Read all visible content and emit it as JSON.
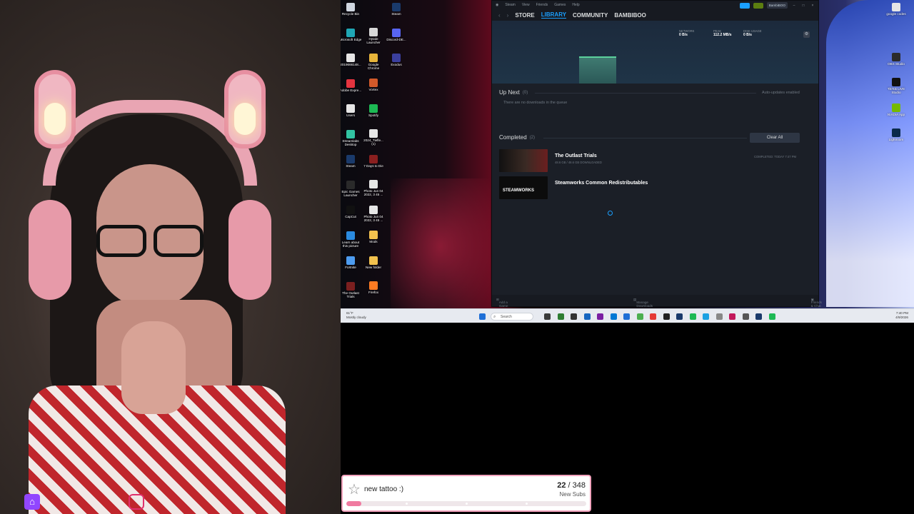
{
  "webcam": {
    "social_icons": [
      "twitch-logo-icon",
      "instagram-logo-icon"
    ]
  },
  "desktop": {
    "icons_col1": [
      {
        "label": "Recycle Bin",
        "icon": "recycle-bin-icon",
        "color": "#cfd6e0"
      },
      {
        "label": "Microsoft Edge",
        "icon": "edge-icon",
        "color": "#1fa7b5"
      },
      {
        "label": "2019666148...",
        "icon": "file-icon",
        "color": "#e6e6e6"
      },
      {
        "label": "Adobe Expre...",
        "icon": "adobe-express-icon",
        "color": "#e4343f"
      },
      {
        "label": "Users",
        "icon": "users-folder-icon",
        "color": "#e6e6e6"
      },
      {
        "label": "Streamlabs Desktop",
        "icon": "streamlabs-icon",
        "color": "#31c3a2"
      },
      {
        "label": "Steam",
        "icon": "steam-icon",
        "color": "#1a3a6b"
      },
      {
        "label": "Epic Games Launcher",
        "icon": "epic-games-icon",
        "color": "#2a2a2a"
      },
      {
        "label": "CapCut",
        "icon": "capcut-icon",
        "color": "#111111"
      },
      {
        "label": "Learn about this picture",
        "icon": "spotlight-icon",
        "color": "#2a8be0"
      },
      {
        "label": "Fortnite",
        "icon": "fortnite-icon",
        "color": "#4d9cf0"
      },
      {
        "label": "The Outlast Trials",
        "icon": "outlast-icon",
        "color": "#7b1f1f"
      }
    ],
    "icons_col2": [
      {
        "label": "Hytale Launcher",
        "icon": "hytale-icon",
        "color": "#d8d8d8"
      },
      {
        "label": "Google Chrome",
        "icon": "chrome-icon",
        "color": "#e7b43a"
      },
      {
        "label": "Vortex",
        "icon": "vortex-icon",
        "color": "#d35a2a"
      },
      {
        "label": "Spotify",
        "icon": "spotify-icon",
        "color": "#1db954"
      },
      {
        "label": "2024_Tiefle... (1)",
        "icon": "file-icon",
        "color": "#e6e6e6"
      },
      {
        "label": "7 Days to Die",
        "icon": "7-days-icon",
        "color": "#8a1f1f"
      },
      {
        "label": "Photo Jun 04 2022, 3 45 ...",
        "icon": "photo-file-icon",
        "color": "#e6e6e6"
      },
      {
        "label": "Photo Jun 04 2022, 3 45 ...",
        "icon": "photo-file-icon",
        "color": "#e6e6e6"
      },
      {
        "label": "Mods",
        "icon": "folder-icon",
        "color": "#f2c14e"
      },
      {
        "label": "New folder",
        "icon": "folder-icon",
        "color": "#f2c14e"
      },
      {
        "label": "Firefox",
        "icon": "firefox-icon",
        "color": "#ff7b22"
      }
    ],
    "icons_col3": [
      {
        "label": "Steam",
        "icon": "steam-icon",
        "color": "#1a3a6b"
      },
      {
        "label": "Discord-DE...",
        "icon": "discord-icon",
        "color": "#5865f2"
      },
      {
        "label": "Exodus",
        "icon": "exodus-icon",
        "color": "#3b3f9e"
      }
    ],
    "icons_right": [
      {
        "label": "google codes",
        "icon": "text-file-icon",
        "color": "#e6e6e6"
      },
      {
        "label": "OBS Studio",
        "icon": "obs-icon",
        "color": "#2b2b2b"
      },
      {
        "label": "TikTok LIVE Studio",
        "icon": "tiktok-icon",
        "color": "#111111"
      },
      {
        "label": "NVIDIA App",
        "icon": "nvidia-icon",
        "color": "#76b900"
      },
      {
        "label": "Lightroom",
        "icon": "lightroom-icon",
        "color": "#0a2a4a"
      }
    ]
  },
  "steam": {
    "menu": [
      "Steam",
      "View",
      "Friends",
      "Games",
      "Help"
    ],
    "user": "BambiBOO",
    "nav_tabs": [
      "STORE",
      "LIBRARY",
      "COMMUNITY",
      "BAMBIBOO"
    ],
    "active_tab": "LIBRARY",
    "stats": [
      {
        "label": "NETWORK",
        "value": "0 B/s"
      },
      {
        "label": "PEAK",
        "value": "112.2 MB/s"
      },
      {
        "label": "DISK USAGE",
        "value": "0 B/s"
      }
    ],
    "up_next": {
      "title": "Up Next",
      "count": "(0)",
      "empty_text": "There are no downloads in the queue",
      "auto_updates": "Auto-updates enabled"
    },
    "completed": {
      "title": "Completed",
      "count": "(2)",
      "clear_label": "Clear All"
    },
    "games": [
      {
        "title": "The Outlast Trials",
        "sub": "48.6 GB / 48.6 GB DOWNLOADED",
        "status": "COMPLETED: TODAY 7:47 PM",
        "thumb_color": "#3a2a24"
      },
      {
        "title": "Steamworks Common Redistributables",
        "sub": "",
        "status": "",
        "thumb_color": "#0c0c0c",
        "thumb_text": "STEAMWORKS"
      }
    ],
    "footer": {
      "add_game": "Add a Game",
      "manage": "Manage Downloads",
      "friends": "Friends & Chat"
    }
  },
  "taskbar": {
    "weather_temp": "61°F",
    "weather_text": "Mostly cloudy",
    "search_placeholder": "Search",
    "time": "7:40 PM",
    "date": "4/9/2026"
  },
  "goal": {
    "title": "new tattoo :)",
    "current": "22",
    "target": "/ 348",
    "unit": "New Subs",
    "progress_fraction": 0.063,
    "accent": "#f07aa0"
  }
}
